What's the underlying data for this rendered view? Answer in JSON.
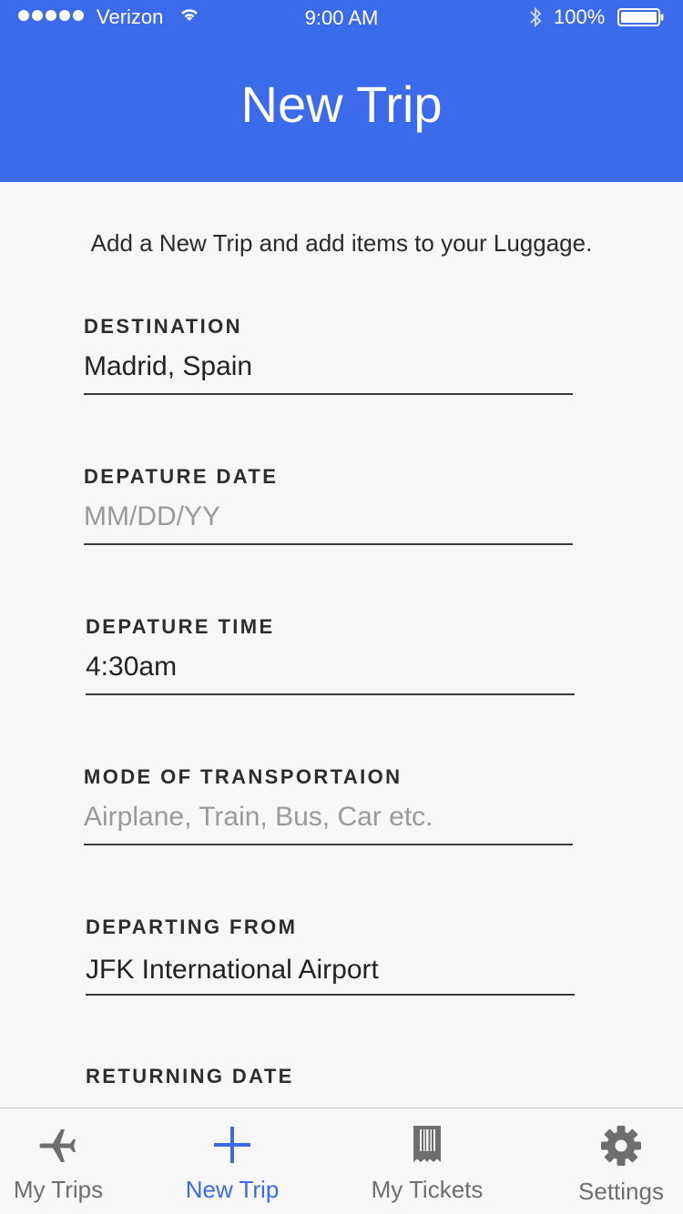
{
  "status_bar": {
    "carrier": "Verizon",
    "time": "9:00 AM",
    "battery": "100%"
  },
  "header": {
    "title": "New Trip",
    "color": "#3b6aea"
  },
  "intro": "Add a New Trip and add items to your Luggage.",
  "form": {
    "destination": {
      "label": "DESTINATION",
      "value": "Madrid, Spain",
      "placeholder": ""
    },
    "departure_date": {
      "label": "DEPATURE DATE",
      "value": "",
      "placeholder": "MM/DD/YY"
    },
    "departure_time": {
      "label": "DEPATURE TIME",
      "value": "4:30am",
      "placeholder": ""
    },
    "mode": {
      "label": "MODE OF TRANSPORTAION",
      "value": "",
      "placeholder": "Airplane, Train, Bus, Car etc."
    },
    "departing_from": {
      "label": "DEPARTING FROM",
      "value": "JFK International Airport"
    },
    "returning_date": {
      "label": "RETURNING DATE"
    }
  },
  "tabbar": {
    "active_color": "#3b6aea",
    "tabs": [
      {
        "label": "My Trips",
        "icon": "airplane-icon"
      },
      {
        "label": "New Trip",
        "icon": "plus-icon",
        "active": true
      },
      {
        "label": "My Tickets",
        "icon": "ticket-icon"
      },
      {
        "label": "Settings",
        "icon": "gear-icon"
      }
    ]
  }
}
